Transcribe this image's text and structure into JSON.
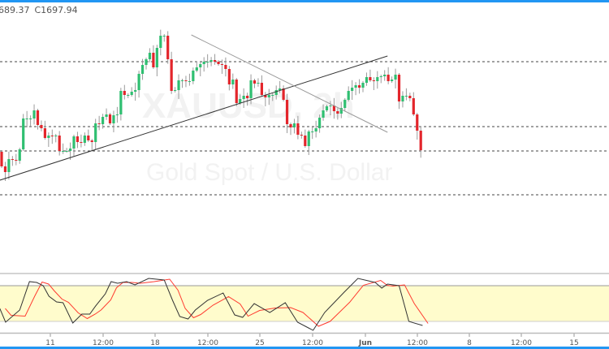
{
  "header": {
    "open_partial": "689.37",
    "close": "C1697.94"
  },
  "watermark": {
    "symbol": "XAUUSD, 2h",
    "description": "Gold Spot / U.S. Dollar"
  },
  "colors": {
    "up": "#2fbf71",
    "down": "#e3252b",
    "wick": "#9a9a9a",
    "accent": "#2196f3",
    "band": "#fffccc",
    "k_line": "#333333",
    "d_line": "#ff3b30"
  },
  "chart_data": {
    "type": "candlestick",
    "title": "XAUUSD, 2h",
    "subtitle": "Gold Spot / U.S. Dollar",
    "y_range": [
      1625.5,
      1790.5
    ],
    "close_last": 1697.94,
    "closes": [
      1688,
      1684.5,
      1692.5,
      1692,
      1691.5,
      1698.5,
      1717.5,
      1717.5,
      1717.5,
      1722.5,
      1713.5,
      1711.5,
      1705.5,
      1707,
      1706.5,
      1707,
      1697.5,
      1697.5,
      1697.5,
      1699,
      1706.5,
      1703,
      1702.5,
      1707,
      1704,
      1703,
      1714.5,
      1714,
      1718.5,
      1720,
      1714.5,
      1719.5,
      1720,
      1734.5,
      1732,
      1732,
      1734,
      1735,
      1745,
      1750.5,
      1754,
      1758,
      1749,
      1761,
      1768.5,
      1768.5,
      1754,
      1734.5,
      1735,
      1741,
      1741,
      1740.5,
      1740.5,
      1747,
      1749,
      1751,
      1752.5,
      1752.5,
      1753.5,
      1752.5,
      1751,
      1750.5,
      1748,
      1738.5,
      1741.5,
      1727,
      1729.5,
      1731.5,
      1730,
      1741,
      1739,
      1739.5,
      1732,
      1730.5,
      1732,
      1732,
      1735,
      1736,
      1729,
      1714,
      1712,
      1714.5,
      1707.5,
      1707,
      1700.5,
      1709.5,
      1709.5,
      1711.5,
      1718,
      1722.5,
      1725,
      1725.5,
      1722,
      1720.5,
      1724,
      1729,
      1734.5,
      1736.5,
      1738,
      1736.5,
      1739.5,
      1743,
      1741,
      1740.5,
      1743,
      1743.5,
      1744.5,
      1740.5,
      1741.5,
      1744.5,
      1728,
      1731.5,
      1731.5,
      1730,
      1720,
      1710,
      1697.94
    ],
    "first_open": 1697,
    "horizontal_levels": [
      1752.5,
      1712.5,
      1697.5,
      1670.5
    ],
    "trend_lines": [
      {
        "name": "support",
        "from": [
          -0.5,
          1679.5
        ],
        "to": [
          106.8,
          1756
        ]
      },
      {
        "name": "resistance",
        "from": [
          52.5,
          1769
        ],
        "to": [
          106.8,
          1709
        ]
      }
    ],
    "x_tick_labels": [
      "11",
      "12:00",
      "18",
      "12:00",
      "25",
      "12:00",
      "Jun",
      "12:00",
      "8",
      "12:00",
      "15"
    ],
    "stochastic": {
      "range": [
        0,
        100
      ],
      "band": [
        20,
        80
      ],
      "k": [
        [
          -0.5,
          41.7
        ],
        [
          1.1,
          18.6
        ],
        [
          5,
          39
        ],
        [
          7.7,
          86.8
        ],
        [
          9.7,
          85.4
        ],
        [
          11.5,
          80
        ],
        [
          13.1,
          62.2
        ],
        [
          15.2,
          52.6
        ],
        [
          17,
          51.3
        ],
        [
          19.7,
          17.2
        ],
        [
          22.2,
          32.2
        ],
        [
          24.4,
          32.2
        ],
        [
          26,
          45.8
        ],
        [
          28.7,
          66.3
        ],
        [
          30.3,
          86.8
        ],
        [
          32.1,
          84
        ],
        [
          34.6,
          86.8
        ],
        [
          36.9,
          81.3
        ],
        [
          40.7,
          92.2
        ],
        [
          45,
          89.5
        ],
        [
          47.3,
          55.4
        ],
        [
          49.3,
          28.1
        ],
        [
          51.6,
          24
        ],
        [
          53.6,
          39
        ],
        [
          57,
          55.4
        ],
        [
          61.3,
          67.7
        ],
        [
          64.5,
          30.8
        ],
        [
          66.7,
          26.7
        ],
        [
          69.9,
          49.9
        ],
        [
          74.2,
          34.9
        ],
        [
          78.5,
          51.3
        ],
        [
          81.9,
          18.6
        ],
        [
          86.2,
          4.9
        ],
        [
          89.4,
          34.9
        ],
        [
          94.8,
          69
        ],
        [
          98.6,
          92.2
        ],
        [
          103.4,
          85.4
        ],
        [
          105.2,
          75.9
        ],
        [
          106.8,
          82.7
        ],
        [
          110,
          80
        ],
        [
          112.7,
          19.9
        ],
        [
          116.5,
          13.1
        ]
      ]
    }
  }
}
